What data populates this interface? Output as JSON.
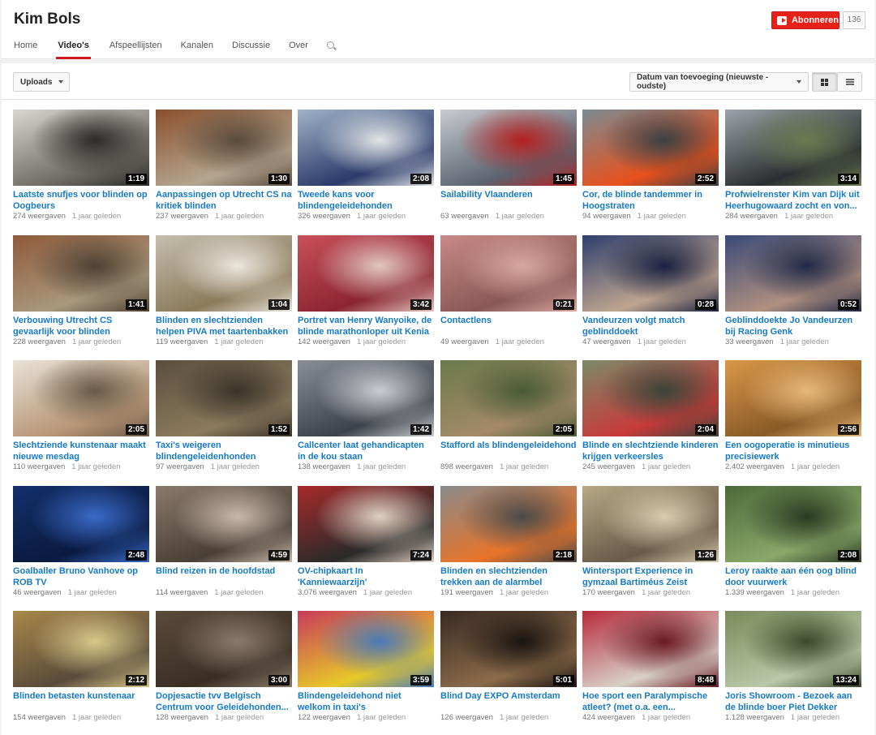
{
  "channel": {
    "title": "Kim Bols",
    "subscribe_label": "Abonneren",
    "subscriber_count": "136"
  },
  "tabs": [
    {
      "label": "Home",
      "active": false
    },
    {
      "label": "Video's",
      "active": true
    },
    {
      "label": "Afspeellijsten",
      "active": false
    },
    {
      "label": "Kanalen",
      "active": false
    },
    {
      "label": "Discussie",
      "active": false
    },
    {
      "label": "Over",
      "active": false
    }
  ],
  "toolbar": {
    "uploads_label": "Uploads",
    "sort_label": "Datum van toevoeging (nieuwste - oudste)"
  },
  "colors": {
    "accent": "#cc181e",
    "link": "#167ac6"
  },
  "videos": [
    {
      "title": "Laatste snufjes voor blinden op Oogbeurs",
      "duration": "1:19",
      "views": "274 weergaven",
      "age": "1 jaar geleden",
      "colors": [
        "#d9d7cf",
        "#6d6a62",
        "#2c2b29"
      ]
    },
    {
      "title": "Aanpassingen op Utrecht CS na kritiek blinden",
      "duration": "1:30",
      "views": "237 weergaven",
      "age": "1 jaar geleden",
      "colors": [
        "#8a4f2c",
        "#b5a590",
        "#5a4a3a"
      ]
    },
    {
      "title": "Tweede kans voor blindengeleidehonden",
      "duration": "2:08",
      "views": "326 weergaven",
      "age": "1 jaar geleden",
      "colors": [
        "#9fb4c8",
        "#2a3a6a",
        "#e2e4e6"
      ]
    },
    {
      "title": "Sailability Vlaanderen",
      "duration": "1:45",
      "views": "63 weergaven",
      "age": "1 jaar geleden",
      "colors": [
        "#c9ccd0",
        "#5b6470",
        "#b42020"
      ]
    },
    {
      "title": "Cor, de blinde tandemmer in Hoogstraten",
      "duration": "2:52",
      "views": "94 weergaven",
      "age": "1 jaar geleden",
      "colors": [
        "#7c8b93",
        "#e8501c",
        "#3a3f42"
      ]
    },
    {
      "title": "Profwielrenster Kim van Dijk uit Heerhugowaard zocht en von...",
      "duration": "3:14",
      "views": "284 weergaven",
      "age": "1 jaar geleden",
      "colors": [
        "#9aa4a8",
        "#2b2e31",
        "#6a7a50"
      ]
    },
    {
      "title": "Verbouwing Utrecht CS gevaarlijk voor blinden",
      "duration": "1:41",
      "views": "228 weergaven",
      "age": "1 jaar geleden",
      "colors": [
        "#8f5a3a",
        "#a9987e",
        "#4f4133"
      ]
    },
    {
      "title": "Blinden en slechtzienden helpen PIVA met taartenbakken",
      "duration": "1:04",
      "views": "119 weergaven",
      "age": "1 jaar geleden",
      "colors": [
        "#c5bfae",
        "#8c7a5c",
        "#e9e6dc"
      ]
    },
    {
      "title": "Portret van Henry Wanyoike, de blinde marathonloper uit Kenia",
      "duration": "3:42",
      "views": "142 weergaven",
      "age": "1 jaar geleden",
      "colors": [
        "#c9505a",
        "#8b2630",
        "#e1c7c0"
      ]
    },
    {
      "title": "Contactlens",
      "duration": "0:21",
      "views": "49 weergaven",
      "age": "1 jaar geleden",
      "colors": [
        "#c98a86",
        "#8a5855",
        "#d8a7a0"
      ]
    },
    {
      "title": "Vandeurzen volgt match geblinddoekt",
      "duration": "0:28",
      "views": "47 weergaven",
      "age": "1 jaar geleden",
      "colors": [
        "#2e3f6e",
        "#bfa590",
        "#1a2140"
      ]
    },
    {
      "title": "Geblinddoekte Jo Vandeurzen bij Racing Genk",
      "duration": "0:52",
      "views": "33 weergaven",
      "age": "1 jaar geleden",
      "colors": [
        "#3a4a78",
        "#b09080",
        "#222a48"
      ]
    },
    {
      "title": "Slechtziende kunstenaar maakt nieuwe mesdag",
      "duration": "2:05",
      "views": "110 weergaven",
      "age": "1 jaar geleden",
      "colors": [
        "#e8e2d6",
        "#b89678",
        "#6a5a48"
      ]
    },
    {
      "title": "Taxi's weigeren blindengeleidenhonden",
      "duration": "1:52",
      "views": "97 weergaven",
      "age": "1 jaar geleden",
      "colors": [
        "#5a4e3c",
        "#8c7a5e",
        "#3a3428"
      ]
    },
    {
      "title": "Callcenter laat gehandicapten in de kou staan",
      "duration": "1:42",
      "views": "138 weergaven",
      "age": "1 jaar geleden",
      "colors": [
        "#8a8f96",
        "#3d4248",
        "#c9cdd2"
      ]
    },
    {
      "title": "Stafford als blindengeleidehond",
      "duration": "2:05",
      "views": "898 weergaven",
      "age": "1 jaar geleden",
      "colors": [
        "#6a7a4a",
        "#a58a6a",
        "#4a5a38"
      ]
    },
    {
      "title": "Blinde en slechtziende kinderen krijgen verkeersles",
      "duration": "2:04",
      "views": "245 weergaven",
      "age": "1 jaar geleden",
      "colors": [
        "#7a8a6a",
        "#c83a3a",
        "#3a4438"
      ]
    },
    {
      "title": "Een oogoperatie is minutieus precisiewerk",
      "duration": "2:56",
      "views": "2.402 weergaven",
      "age": "1 jaar geleden",
      "colors": [
        "#d89848",
        "#8a5a28",
        "#e8b878"
      ]
    },
    {
      "title": "Goalballer Bruno Vanhove op ROB TV",
      "duration": "2:48",
      "views": "46 weergaven",
      "age": "1 jaar geleden",
      "colors": [
        "#14306a",
        "#0a1a40",
        "#3a6ac8"
      ]
    },
    {
      "title": "Blind reizen in de hoofdstad",
      "duration": "4:59",
      "views": "114 weergaven",
      "age": "1 jaar geleden",
      "colors": [
        "#8a7a6a",
        "#4a3f36",
        "#c8b8a8"
      ]
    },
    {
      "title": "OV-chipkaart In 'Kanniewaarzijn'",
      "duration": "7:24",
      "views": "3.076 weergaven",
      "age": "1 jaar geleden",
      "colors": [
        "#a82a2a",
        "#2a2a2a",
        "#e0d0c0"
      ]
    },
    {
      "title": "Blinden en slechtzienden trekken aan de alarmbel",
      "duration": "2:18",
      "views": "191 weergaven",
      "age": "1 jaar geleden",
      "colors": [
        "#8a8a8a",
        "#e8742a",
        "#4a4a4a"
      ]
    },
    {
      "title": "Wintersport Experience in gymzaal Bartiméus Zeist",
      "duration": "1:26",
      "views": "170 weergaven",
      "age": "1 jaar geleden",
      "colors": [
        "#b8a888",
        "#6a5a48",
        "#d8cbb0"
      ]
    },
    {
      "title": "Leroy raakte aan één oog blind door vuurwerk",
      "duration": "2:08",
      "views": "1.339 weergaven",
      "age": "1 jaar geleden",
      "colors": [
        "#4a6a3a",
        "#8aa86a",
        "#2a3a22"
      ]
    },
    {
      "title": "Blinden betasten kunstenaar",
      "duration": "2:12",
      "views": "154 weergaven",
      "age": "1 jaar geleden",
      "colors": [
        "#a8884a",
        "#5a4a3a",
        "#d8c88a"
      ]
    },
    {
      "title": "Dopjesactie tvv Belgisch Centrum voor Geleidehonden...",
      "duration": "3:00",
      "views": "128 weergaven",
      "age": "1 jaar geleden",
      "colors": [
        "#5a4a3a",
        "#3a2e24",
        "#8a7a6a"
      ]
    },
    {
      "title": "Blindengeleidehond niet welkom in taxi's",
      "duration": "3:59",
      "views": "122 weergaven",
      "age": "1 jaar geleden",
      "colors": [
        "#c83a5a",
        "#e8c82a",
        "#4a7ab8"
      ]
    },
    {
      "title": "Blind Day EXPO Amsterdam",
      "duration": "5:01",
      "views": "126 weergaven",
      "age": "1 jaar geleden",
      "colors": [
        "#3a2a22",
        "#8a6a4a",
        "#1a1410"
      ]
    },
    {
      "title": "Hoe sport een Paralympische atleet? (met o.a. een...",
      "duration": "8:48",
      "views": "424 weergaven",
      "age": "1 jaar geleden",
      "colors": [
        "#b82a3a",
        "#d8d0c8",
        "#6a1a22"
      ]
    },
    {
      "title": "Joris Showroom - Bezoek aan de blinde boer Piet Dekker",
      "duration": "13:24",
      "views": "1.128 weergaven",
      "age": "1 jaar geleden",
      "colors": [
        "#7a8a5a",
        "#b8c8a8",
        "#3a4a2a"
      ]
    }
  ]
}
